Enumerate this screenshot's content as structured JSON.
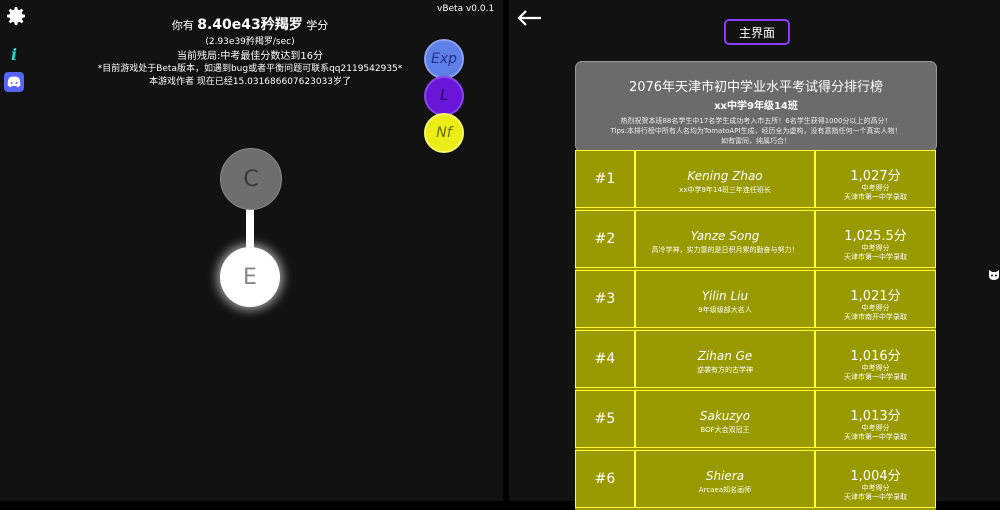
{
  "left": {
    "line1_prefix": "你有",
    "line1_amount": "8.40e43矜羯罗",
    "line1_suffix": "学分",
    "line2": "(2.93e39矜羯罗/sec)",
    "line3": "当前残局:中考最佳分数达到16分",
    "line4": "*目前游戏处于Beta版本，如遇到bug或者平衡问题可联系qq2119542935*",
    "line5": "本游戏作者 现在已经15.031686607623033岁了",
    "version": "vBeta v0.0.1",
    "tabs": {
      "exp": "Exp",
      "l": "L",
      "nf": "Nf"
    },
    "nodes": {
      "c": "C",
      "e": "E"
    },
    "info_icon": "i"
  },
  "right": {
    "main_button": "主界面",
    "header": {
      "title": "2076年天津市初中学业水平考试得分排行榜",
      "subtitle": "xx中学9年级14班",
      "desc1": "热烈祝贺本班88名学生中17名学生成功考入市五所！6名学生获得1000分以上的高分！",
      "desc2": "Tips:本排行榜中所有人名均为TomatoAPI生成，经历全为虚构，没有意指任何一个真实人物！",
      "desc3": "如有雷同，纯属巧合！"
    },
    "rows": [
      {
        "rank": "#1",
        "name": "Kening Zhao",
        "note": "xx中学9年14班三年连任班长",
        "score": "1,027分",
        "l1": "中考得分",
        "l2": "天津市第一中学录取"
      },
      {
        "rank": "#2",
        "name": "Yanze Song",
        "note": "高冷学神，实力靠的是日积月累的勤奋与努力！",
        "score": "1,025.5分",
        "l1": "中考得分",
        "l2": "天津市第一中学录取"
      },
      {
        "rank": "#3",
        "name": "Yilin Liu",
        "note": "9年级级部大名人",
        "score": "1,021分",
        "l1": "中考得分",
        "l2": "天津市南开中学录取"
      },
      {
        "rank": "#4",
        "name": "Zihan Ge",
        "note": "逆袭有方的古学神",
        "score": "1,016分",
        "l1": "中考得分",
        "l2": "天津市第一中学录取"
      },
      {
        "rank": "#5",
        "name": "Sakuzyo",
        "note": "BOF大会双冠王",
        "score": "1,013分",
        "l1": "中考得分",
        "l2": "天津市第一中学录取"
      },
      {
        "rank": "#6",
        "name": "Shiera",
        "note": "Arcaea知名画师",
        "score": "1,004分",
        "l1": "中考得分",
        "l2": "天津市第一中学录取"
      }
    ]
  },
  "icons": [
    "gear-icon",
    "info-icon",
    "discord-icon",
    "back-arrow-icon",
    "cat-icon"
  ]
}
